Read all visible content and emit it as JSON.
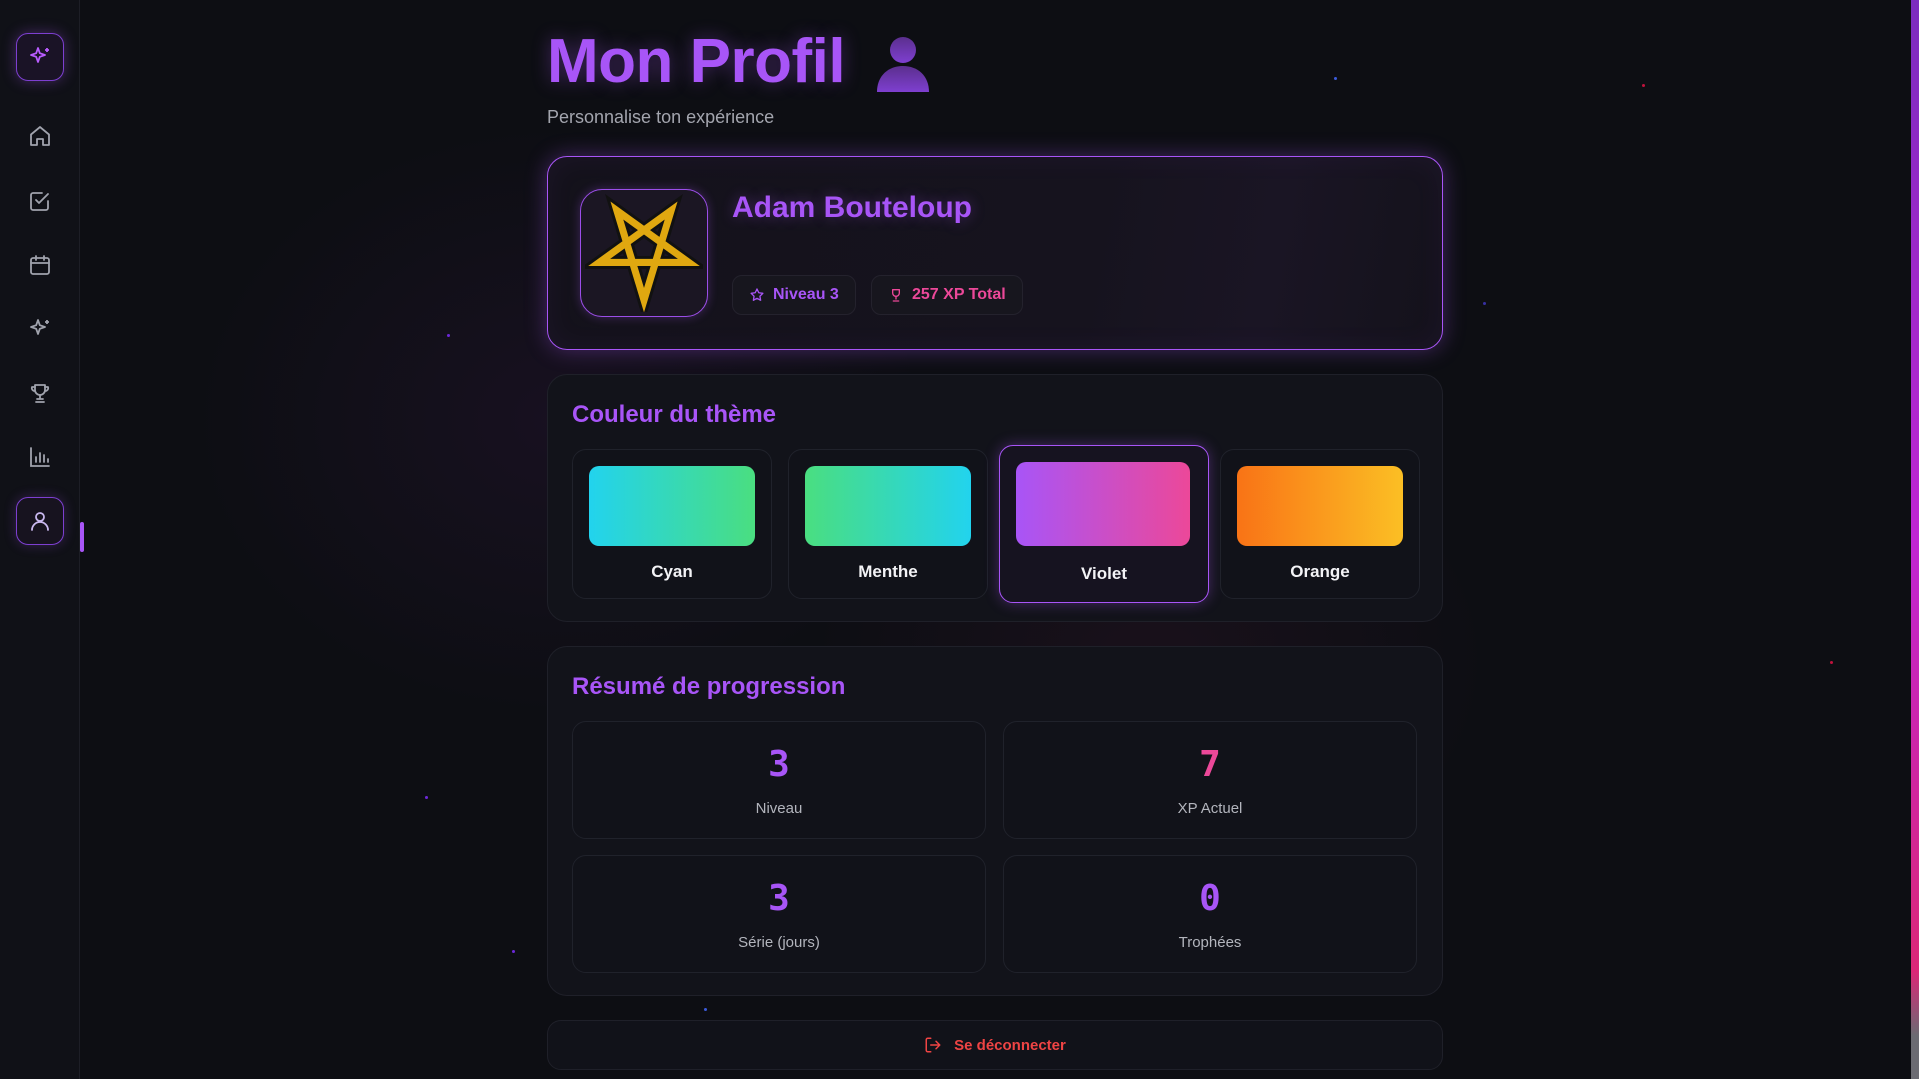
{
  "page": {
    "title": "Mon Profil",
    "subtitle": "Personnalise ton expérience"
  },
  "sidebar": {
    "items": [
      {
        "name": "sparkles-logo",
        "icon": "sparkles-icon"
      },
      {
        "name": "home",
        "icon": "home-icon"
      },
      {
        "name": "tasks",
        "icon": "check-square-icon"
      },
      {
        "name": "calendar",
        "icon": "calendar-icon"
      },
      {
        "name": "sparkles",
        "icon": "sparkles-icon"
      },
      {
        "name": "trophies",
        "icon": "trophy-icon"
      },
      {
        "name": "stats",
        "icon": "bar-chart-icon"
      },
      {
        "name": "profile",
        "icon": "user-icon",
        "active": true
      }
    ]
  },
  "profile": {
    "name": "Adam Bouteloup",
    "avatar_icon": "pentagram-icon",
    "level_badge": "Niveau 3",
    "xp_badge": "257 XP Total"
  },
  "theme": {
    "title": "Couleur du thème",
    "selected": "Violet",
    "options": [
      {
        "label": "Cyan",
        "from": "#22d3ee",
        "to": "#4ade80"
      },
      {
        "label": "Menthe",
        "from": "#4ade80",
        "to": "#22d3ee"
      },
      {
        "label": "Violet",
        "from": "#a855f7",
        "to": "#ec4899"
      },
      {
        "label": "Orange",
        "from": "#f97316",
        "to": "#fbbf24"
      }
    ]
  },
  "progress": {
    "title": "Résumé de progression",
    "stats": [
      {
        "value": "3",
        "label": "Niveau",
        "color": "#a855f7"
      },
      {
        "value": "7",
        "label": "XP Actuel",
        "color": "#ec4899"
      },
      {
        "value": "3",
        "label": "Série (jours)",
        "color": "#a855f7"
      },
      {
        "value": "0",
        "label": "Trophées",
        "color": "#a855f7"
      }
    ]
  },
  "logout": {
    "label": "Se déconnecter"
  },
  "colors": {
    "accent": "#a855f7",
    "accent_pink": "#ec4899",
    "danger": "#ef4444",
    "background": "#0d0e13"
  }
}
